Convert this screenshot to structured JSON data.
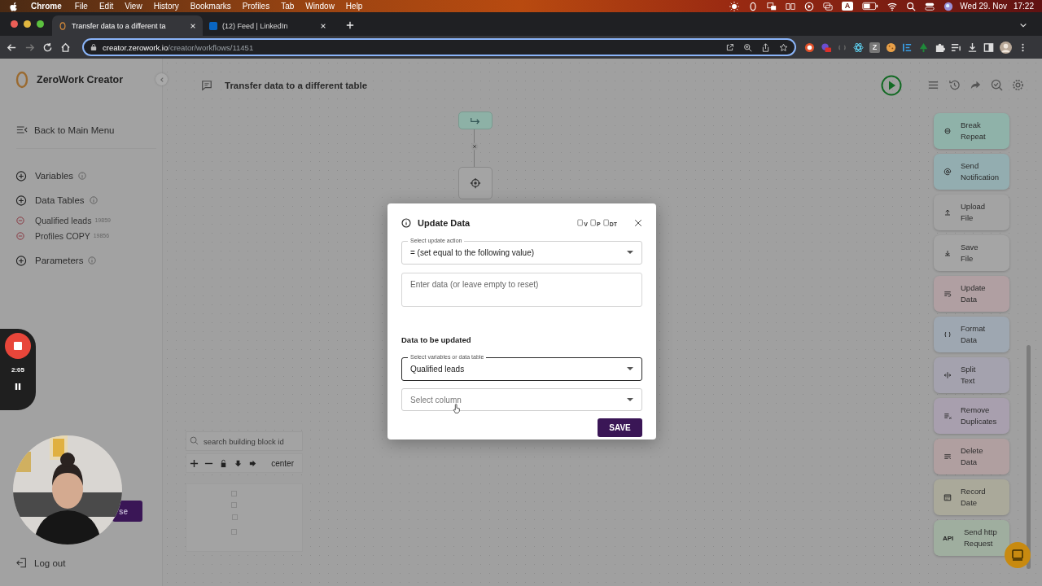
{
  "menu_bar": {
    "app": "Chrome",
    "menus": [
      "File",
      "Edit",
      "View",
      "History",
      "Bookmarks",
      "Profiles",
      "Tab",
      "Window",
      "Help"
    ],
    "input_source": "A",
    "date": "Wed 29. Nov",
    "time": "17:22"
  },
  "browser": {
    "tabs": [
      {
        "title": "Transfer data to a different ta",
        "selected": true
      },
      {
        "title": "(12) Feed | LinkedIn",
        "selected": false
      }
    ],
    "url_host": "creator.zerowork.io",
    "url_path": "/creator/workflows/11451",
    "extension_letter": "Z"
  },
  "sidebar": {
    "brand": "ZeroWork Creator",
    "back": "Back to Main Menu",
    "sections": [
      {
        "label": "Variables"
      },
      {
        "label": "Data Tables",
        "children": [
          {
            "label": "Qualified leads",
            "count": "19859"
          },
          {
            "label": "Profiles COPY",
            "count": "19856"
          }
        ]
      },
      {
        "label": "Parameters"
      }
    ],
    "logout": "Log out"
  },
  "workflow": {
    "title": "Transfer data to a different table"
  },
  "canvas": {
    "search_placeholder": "search building block id",
    "center": "center"
  },
  "palette": [
    {
      "lines": [
        "Break",
        "Repeat"
      ],
      "color": "#8fb2a9"
    },
    {
      "lines": [
        "Send",
        "Notification"
      ],
      "color": "#93adb0"
    },
    {
      "lines": [
        "Upload",
        "File"
      ],
      "color": "#a3a3a3"
    },
    {
      "lines": [
        "Save",
        "File"
      ],
      "color": "#a5a5a5"
    },
    {
      "lines": [
        "Update",
        "Data"
      ],
      "color": "#b09fa2"
    },
    {
      "lines": [
        "Format",
        "Data"
      ],
      "color": "#9ea7b1"
    },
    {
      "lines": [
        "Split",
        "Text"
      ],
      "color": "#a4a2ae"
    },
    {
      "lines": [
        "Remove",
        "Duplicates"
      ],
      "color": "#a89fae"
    },
    {
      "lines": [
        "Delete",
        "Data"
      ],
      "color": "#b09fa0"
    },
    {
      "lines": [
        "Record",
        "Date"
      ],
      "color": "#aaa99a"
    },
    {
      "lines": [
        "Send http",
        "Request"
      ],
      "color": "#9fae9f",
      "icon_text": "API"
    }
  ],
  "modal": {
    "title": "Update Data",
    "tool_labels": [
      "V",
      "P",
      "DT"
    ],
    "action": {
      "label": "Select update action",
      "value": "= (set equal to the following value)",
      "focused": false
    },
    "data_input": {
      "placeholder": "Enter data (or leave empty to reset)"
    },
    "section_title": "Data to be updated",
    "target": {
      "label": "Select variables or data table",
      "value": "Qualified leads",
      "focused": true
    },
    "column": {
      "placeholder": "Select column",
      "focused": false
    },
    "save": "SAVE"
  },
  "recorder": {
    "time": "2:05"
  },
  "webcam": {
    "button_text": "se"
  }
}
